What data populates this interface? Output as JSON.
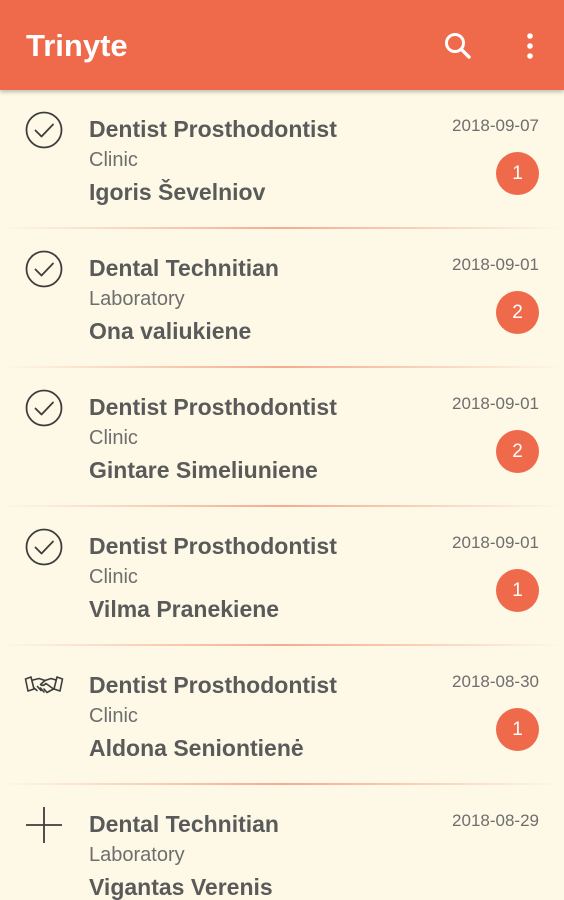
{
  "app": {
    "title": "Trinyte",
    "accent_color": "#ef6a4b",
    "background_color": "#fdf9e6",
    "actions": [
      "search-icon",
      "more-vert-icon"
    ]
  },
  "items": [
    {
      "icon": "check-circle-icon",
      "title": "Dentist Prosthodontist",
      "type": "Clinic",
      "person": "Igoris Ševelniov",
      "date": "2018-09-07",
      "badge": "1"
    },
    {
      "icon": "check-circle-icon",
      "title": "Dental Technitian",
      "type": "Laboratory",
      "person": "Ona valiukiene",
      "date": "2018-09-01",
      "badge": "2"
    },
    {
      "icon": "check-circle-icon",
      "title": "Dentist Prosthodontist",
      "type": "Clinic",
      "person": "Gintare Simeliuniene",
      "date": "2018-09-01",
      "badge": "2"
    },
    {
      "icon": "check-circle-icon",
      "title": "Dentist Prosthodontist",
      "type": "Clinic",
      "person": "Vilma Pranekiene",
      "date": "2018-09-01",
      "badge": "1"
    },
    {
      "icon": "handshake-icon",
      "title": "Dentist Prosthodontist",
      "type": "Clinic",
      "person": "Aldona Seniontienė",
      "date": "2018-08-30",
      "badge": "1"
    },
    {
      "icon": "plus-icon",
      "title": "Dental Technitian",
      "type": "Laboratory",
      "person": "Vigantas Verenis",
      "date": "2018-08-29",
      "badge": ""
    }
  ]
}
